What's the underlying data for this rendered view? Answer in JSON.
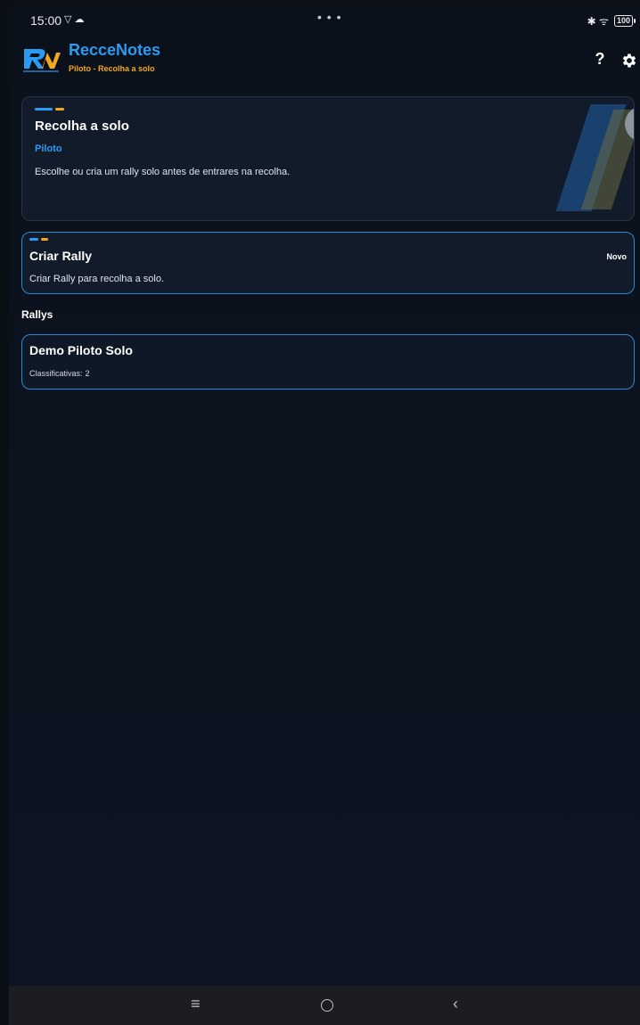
{
  "status_bar": {
    "time": "15:00",
    "left_icons": "▽ ☁",
    "dots": "• • •",
    "right_icons": "✱ ᯤ",
    "battery": "100"
  },
  "header": {
    "app_title": "RecceNotes",
    "subtitle": "Piloto - Recolha a solo",
    "logo_text": "RN",
    "help_label": "?",
    "colors": {
      "brand_blue": "#2a9bf2",
      "brand_orange": "#f5a623"
    }
  },
  "hero": {
    "title": "Recolha a solo",
    "role": "Piloto",
    "description": "Escolhe ou cria um rally solo antes de entrares na recolha."
  },
  "create_rally": {
    "title": "Criar Rally",
    "badge": "Novo",
    "description": "Criar Rally para recolha a solo."
  },
  "rallies": {
    "section_title": "Rallys",
    "items": [
      {
        "name": "Demo Piloto Solo",
        "stages_label": "Classificativas:",
        "stages_count": "2"
      }
    ]
  },
  "nav_bar": {
    "menu_glyph": "≡",
    "back_glyph": "‹"
  }
}
